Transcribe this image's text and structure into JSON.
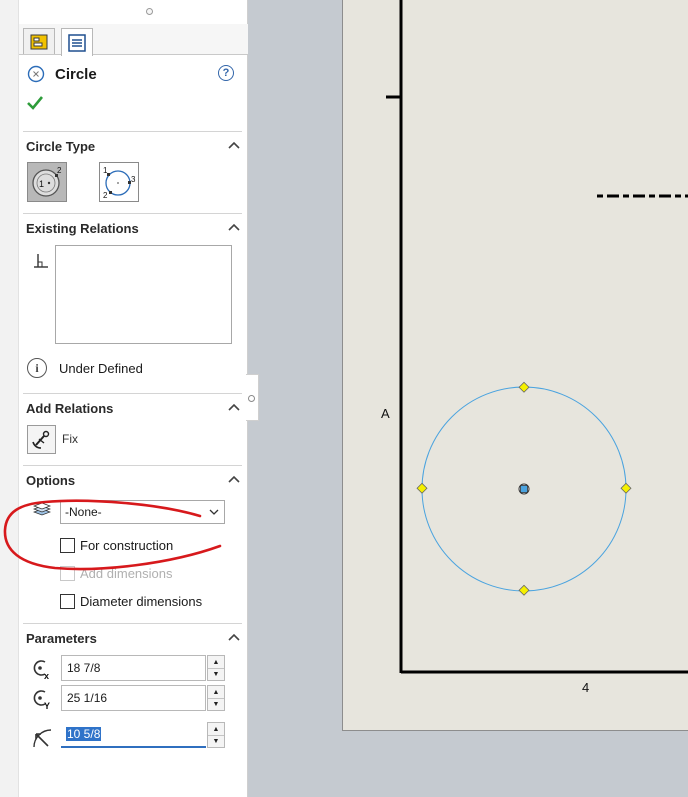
{
  "panel": {
    "title": "Circle",
    "help_symbol": "?",
    "circle_type": {
      "heading": "Circle Type",
      "options": [
        "center-radius-circle",
        "perimeter-circle"
      ],
      "selected": "center-radius-circle"
    },
    "existing_relations": {
      "heading": "Existing Relations",
      "items": [],
      "status": "Under Defined"
    },
    "add_relations": {
      "heading": "Add Relations",
      "fix_label": "Fix"
    },
    "options": {
      "heading": "Options",
      "layer_value": "-None-",
      "for_construction": "For construction",
      "add_dimensions": "Add dimensions",
      "diameter_dimensions": "Diameter dimensions"
    },
    "parameters": {
      "heading": "Parameters",
      "center_x": "18 7/8",
      "center_y": "25 1/16",
      "radius": "10 5/8"
    }
  },
  "drawing": {
    "zone_label_left": "A",
    "zone_label_bottom": "4",
    "circle_color": "#4aa3df",
    "handle_color": "#f5f000"
  },
  "annotation": {
    "color": "#d7191c"
  }
}
